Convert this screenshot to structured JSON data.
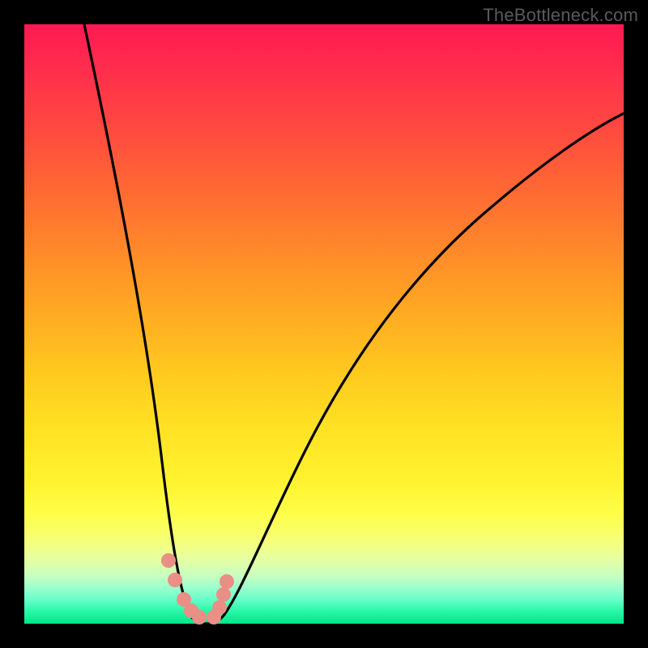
{
  "watermark": "TheBottleneck.com",
  "chart_data": {
    "type": "line",
    "title": "",
    "xlabel": "",
    "ylabel": "",
    "xlim": [
      0,
      100
    ],
    "ylim": [
      0,
      100
    ],
    "grid": false,
    "legend": false,
    "series": [
      {
        "name": "bottleneck-curve",
        "x": [
          10,
          14,
          18,
          22,
          24,
          26,
          27,
          28,
          29,
          30,
          31,
          33,
          35,
          38,
          42,
          48,
          55,
          65,
          78,
          90,
          100
        ],
        "values": [
          100,
          75,
          50,
          26,
          14,
          6,
          3,
          1,
          0,
          0,
          0,
          1,
          3,
          7,
          14,
          26,
          40,
          55,
          68,
          76,
          80
        ]
      },
      {
        "name": "dotted-overlay",
        "x": [
          24,
          25,
          26.5,
          27.5,
          29,
          32,
          32.8,
          33.4,
          33.8
        ],
        "values": [
          10,
          7,
          3.5,
          1.8,
          0.6,
          0.6,
          2.4,
          4.6,
          7
        ]
      }
    ],
    "colors": {
      "curve": "#000000",
      "dots": "#e98f86"
    },
    "annotations": []
  }
}
